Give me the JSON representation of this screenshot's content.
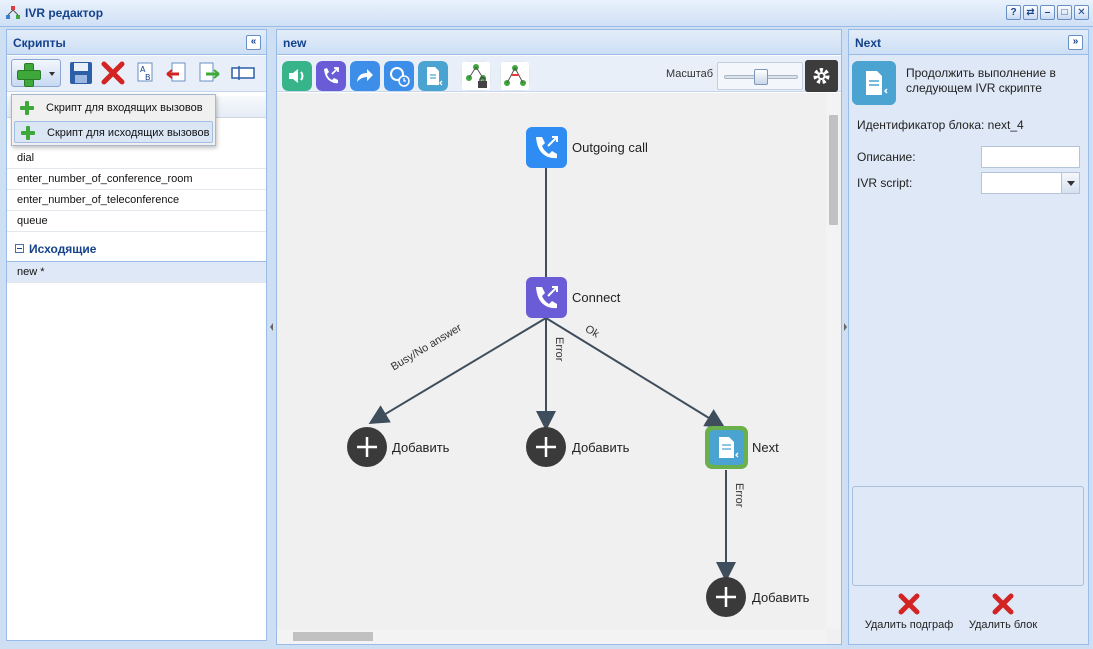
{
  "window": {
    "title": "IVR редактор",
    "buttons": [
      "?",
      "⇄",
      "–",
      "□",
      "✕"
    ]
  },
  "left_panel": {
    "title": "Скрипты",
    "collapse_glyph": "«",
    "add_menu": [
      {
        "label": "Скрипт для входящих вызовов",
        "active": false
      },
      {
        "label": "Скрипт для исходящих вызовов",
        "active": true
      }
    ],
    "incoming_scripts": [
      "dial",
      "enter_number_of_conference_room",
      "enter_number_of_teleconference",
      "queue"
    ],
    "outgoing_group": "Исходящие",
    "outgoing_scripts": [
      "new *"
    ]
  },
  "center_panel": {
    "title": "new",
    "zoom_label": "Масштаб",
    "zoom_level": 0.5,
    "nodes": {
      "outgoing_call": "Outgoing call",
      "connect": "Connect",
      "next": "Next",
      "add1": "Добавить",
      "add2": "Добавить",
      "add3": "Добавить",
      "add4": "Добавить"
    },
    "edges": {
      "busy": "Busy/No answer",
      "error1": "Error",
      "ok": "Ok",
      "error2": "Error"
    },
    "colors": {
      "call_node": "#2f8cf3",
      "connect_node": "#6a5cd6",
      "next_node": "#4aa3d0",
      "next_border": "#6ab04c",
      "add_node": "#3a3a3a",
      "edge": "#3f4e5c"
    }
  },
  "right_panel": {
    "title": "Next",
    "collapse_glyph": "»",
    "description": "Продолжить выполнение в следующем IVR скрипте",
    "block_id": "Идентификатор блока: next_4",
    "description_label": "Описание:",
    "description_value": "",
    "ivr_script_label": "IVR script:",
    "ivr_script_value": "",
    "delete_subgraph": "Удалить подграф",
    "delete_block": "Удалить блок"
  }
}
